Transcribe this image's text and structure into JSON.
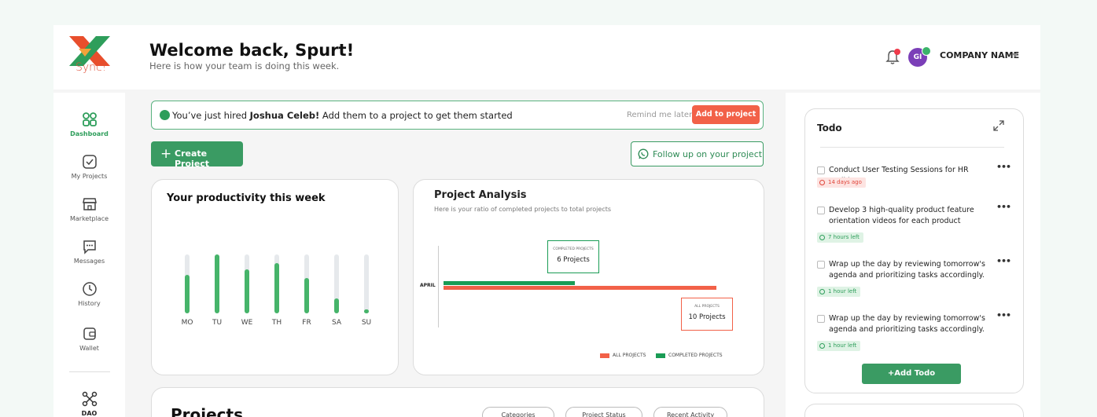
{
  "header": {
    "logo_text": "Sync!",
    "welcome": "Welcome back, Spurt!",
    "subtitle": "Here is how your team is doing this week.",
    "avatar_initials": "GI",
    "company_name": "COMPANY NAME"
  },
  "sidebar": {
    "items": [
      {
        "label": "Dashboard",
        "icon": "dashboard-icon",
        "active": true
      },
      {
        "label": "My Projects",
        "icon": "check-square-icon"
      },
      {
        "label": "Marketplace",
        "icon": "store-icon"
      },
      {
        "label": "Messages",
        "icon": "message-icon"
      },
      {
        "label": "History",
        "icon": "clock-icon"
      },
      {
        "label": "Wallet",
        "icon": "wallet-icon"
      },
      {
        "label": "DAO",
        "icon": "network-icon"
      }
    ]
  },
  "notice": {
    "text_before": "You’ve just hired ",
    "name": "Joshua Celeb!",
    "text_after": " Add them to a project to get them started",
    "remind_label": "Remind me later",
    "add_label": "Add to project"
  },
  "actions": {
    "create_label": "Create Project",
    "follow_label": "Follow up on your project"
  },
  "productivity": {
    "title": "Your productivity this week",
    "days": [
      "MO",
      "TU",
      "WE",
      "TH",
      "FR",
      "SA",
      "SU"
    ],
    "values": [
      0.65,
      1.0,
      0.75,
      0.85,
      0.6,
      0.25,
      0.06
    ]
  },
  "analysis": {
    "title": "Project Analysis",
    "subtitle": "Here is  your ratio of  completed projects to total projects",
    "category_label": "APRIL",
    "completed_tip_caption": "COMPLETED PROJECTS",
    "completed_tip_value": "6 Projects",
    "all_tip_caption": "ALL PROJECTS",
    "all_tip_value": "10 Projects",
    "legend_all": "ALL PROJECTS",
    "legend_completed": "COMPLETED PROJECTS",
    "colors": {
      "all": "#f26148",
      "completed": "#1a9c55"
    }
  },
  "chart_data": {
    "type": "bar",
    "orientation": "horizontal",
    "categories": [
      "APRIL"
    ],
    "series": [
      {
        "name": "ALL PROJECTS",
        "values": [
          10
        ]
      },
      {
        "name": "COMPLETED PROJECTS",
        "values": [
          6
        ]
      }
    ],
    "xlim": [
      0,
      10.5
    ]
  },
  "projects": {
    "title": "Projects",
    "filters": [
      "Categories",
      "Project Status",
      "Recent Activity"
    ]
  },
  "todo": {
    "title": "Todo",
    "items": [
      {
        "text": "Conduct User Testing Sessions for HR Toolkit",
        "tag": "14 days ago",
        "status": "overdue"
      },
      {
        "text": "Develop 3 high-quality product feature orientation videos for each product",
        "tag": "7 hours left",
        "status": "ok"
      },
      {
        "text": "Wrap up the day by reviewing tomorrow's agenda and prioritizing tasks accordingly.",
        "tag": "1 hour left",
        "status": "ok"
      },
      {
        "text": "Wrap up the day by reviewing tomorrow's agenda and prioritizing tasks accordingly.",
        "tag": "1 hour left",
        "status": "ok"
      }
    ],
    "add_label": "+Add Todo"
  }
}
